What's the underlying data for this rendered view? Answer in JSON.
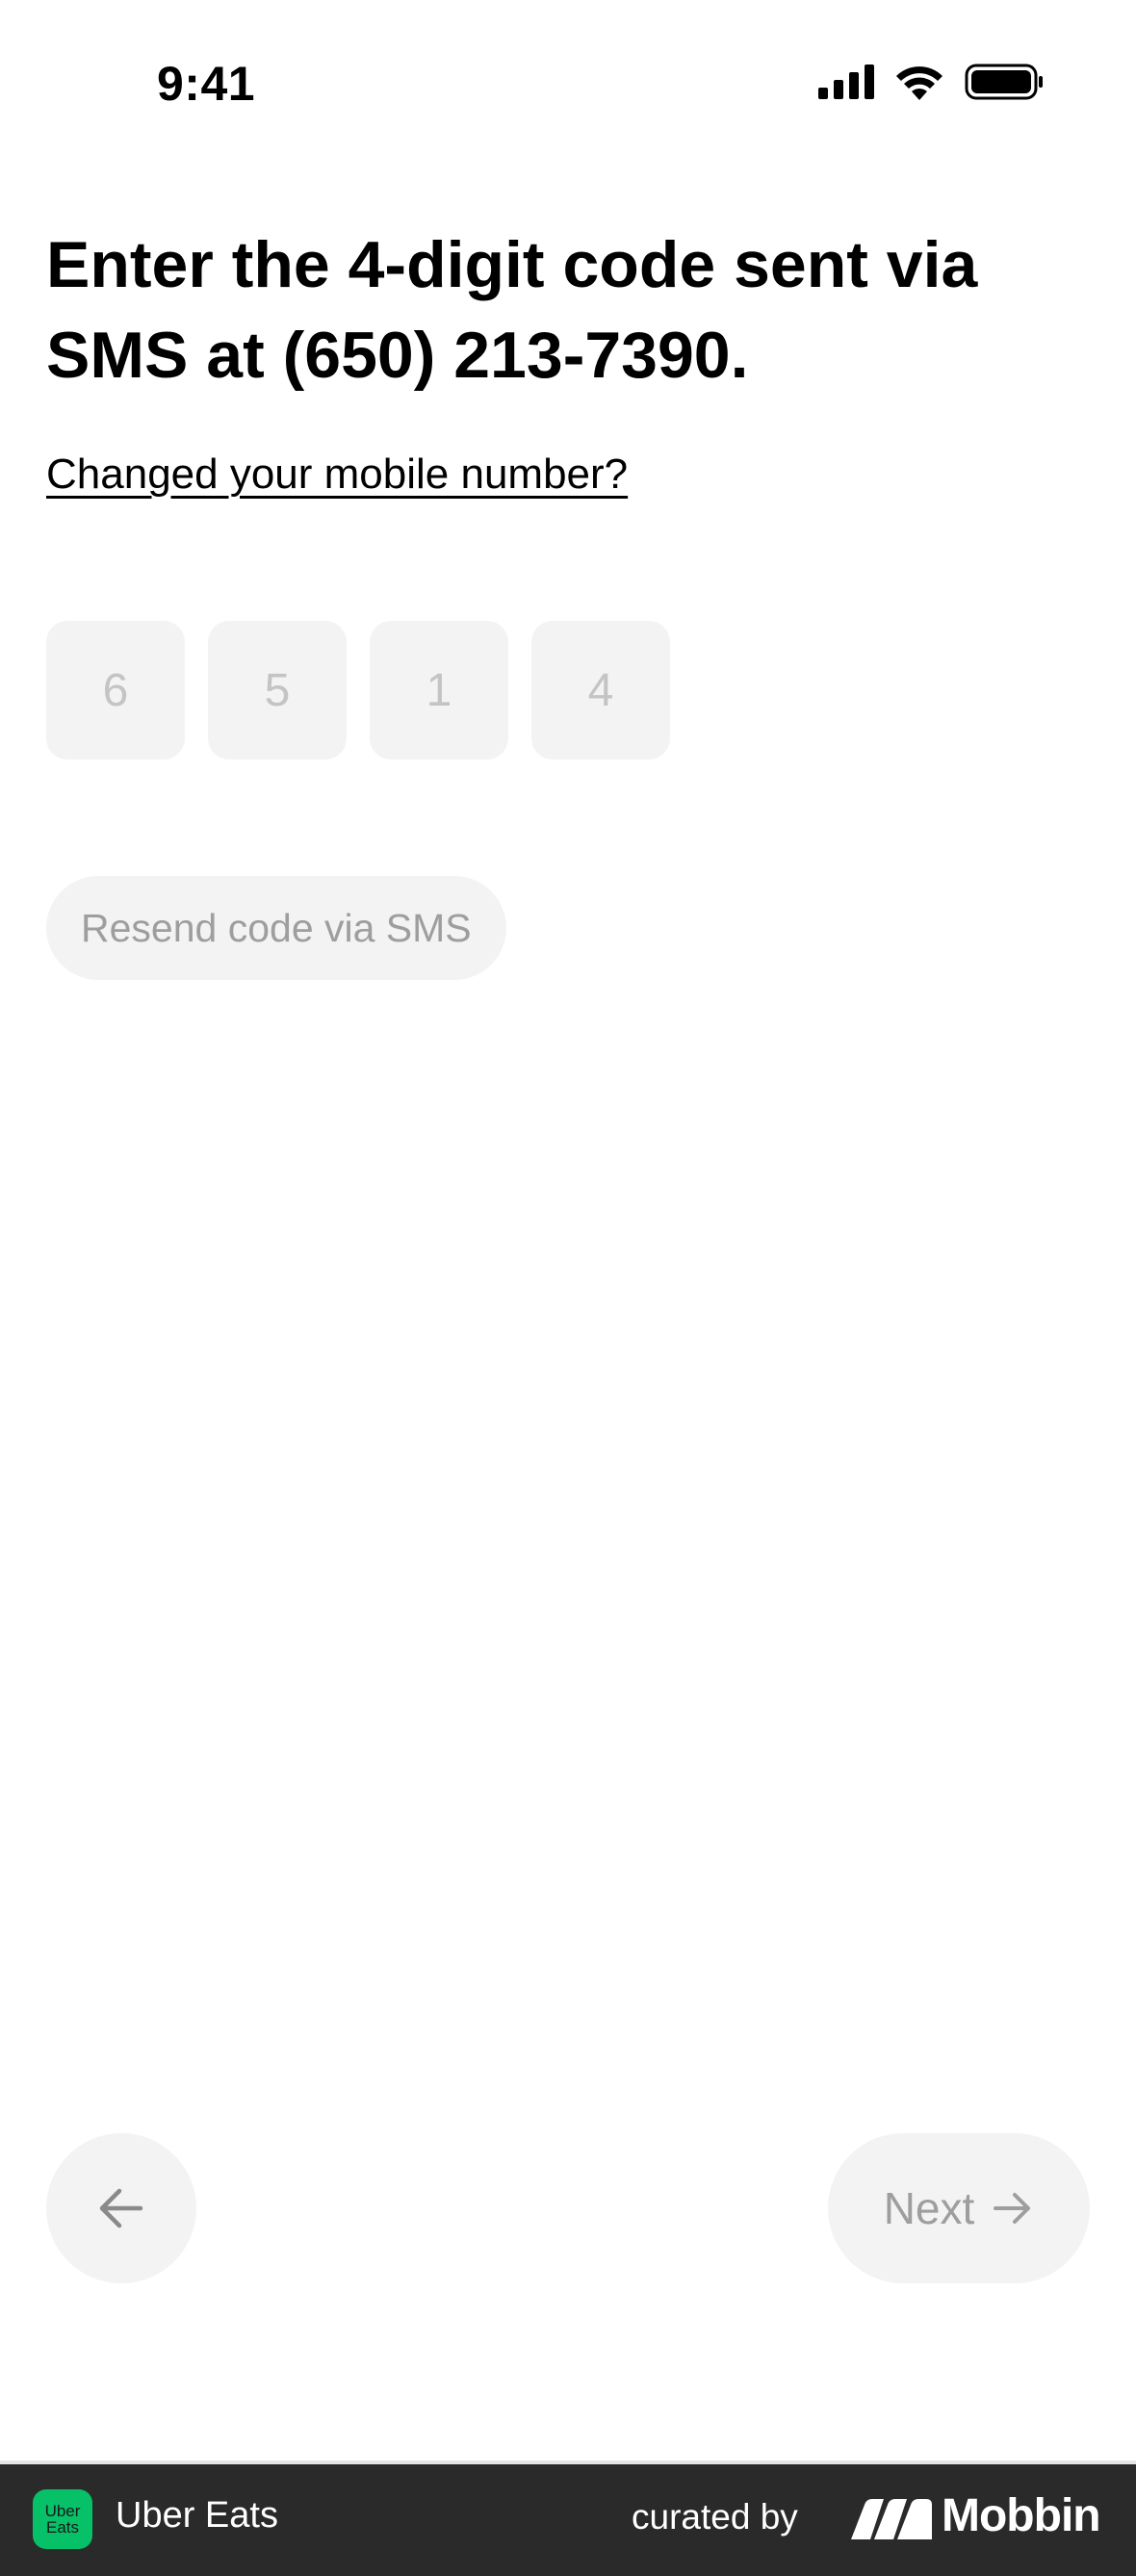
{
  "status_bar": {
    "time": "9:41",
    "icons": [
      "cellular-signal-icon",
      "wifi-icon",
      "battery-icon"
    ]
  },
  "heading": {
    "title": "Enter the 4-digit code sent via SMS at (650) 213-7390.",
    "change_number_link": "Changed your mobile number?"
  },
  "code_input": {
    "digits": [
      "6",
      "5",
      "1",
      "4"
    ]
  },
  "resend": {
    "label": "Resend code via SMS"
  },
  "navigation": {
    "back_icon": "arrow-left-icon",
    "next_label": "Next",
    "next_icon": "arrow-right-icon"
  },
  "footer": {
    "app_logo_line1": "Uber",
    "app_logo_line2": "Eats",
    "app_name": "Uber Eats",
    "curated_label": "curated by",
    "brand_name": "Mobbin"
  },
  "colors": {
    "background": "#ffffff",
    "field_bg": "#f3f3f3",
    "disabled_text": "#9e9e9e",
    "placeholder_digit": "#c4c4c4",
    "footer_bg": "#2a2a2a",
    "app_logo_green": "#06c167"
  }
}
